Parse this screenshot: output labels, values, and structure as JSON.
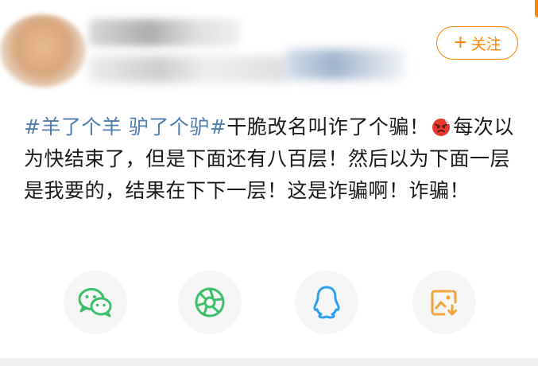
{
  "header": {
    "follow_plus": "+",
    "follow_label": "关注"
  },
  "post": {
    "topic": "#羊了个羊 驴了个驴#",
    "line1_rest": "干脆改名叫诈了个骗！",
    "emoji": "angry-face-emoji",
    "line1_tail": "每",
    "body": "次以为快结束了，但是下面还有八百层！然后以为下面一层是我要的，结果在下下一层！这是诈骗啊！诈骗！"
  },
  "share": {
    "items": [
      {
        "icon": "wechat-icon",
        "color": "#3bbf6a"
      },
      {
        "icon": "moments-icon",
        "color": "#3bbf6a"
      },
      {
        "icon": "qq-icon",
        "color": "#2d9ff0"
      },
      {
        "icon": "save-image-icon",
        "color": "#f2a33a"
      }
    ]
  },
  "colors": {
    "accent": "#ff8200",
    "topic": "#507daf"
  }
}
